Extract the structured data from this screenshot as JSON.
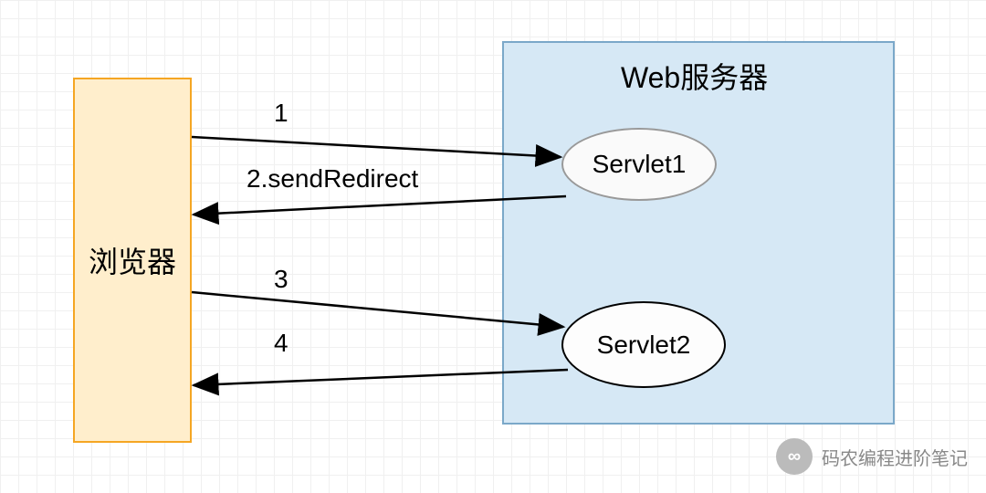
{
  "browser_label": "浏览器",
  "server_title": "Web服务器",
  "servlet1_label": "Servlet1",
  "servlet2_label": "Servlet2",
  "arrows": {
    "a1": "1",
    "a2": "2.sendRedirect",
    "a3": "3",
    "a4": "4"
  },
  "watermark": {
    "icon": "∞",
    "text": "码农编程进阶笔记"
  }
}
